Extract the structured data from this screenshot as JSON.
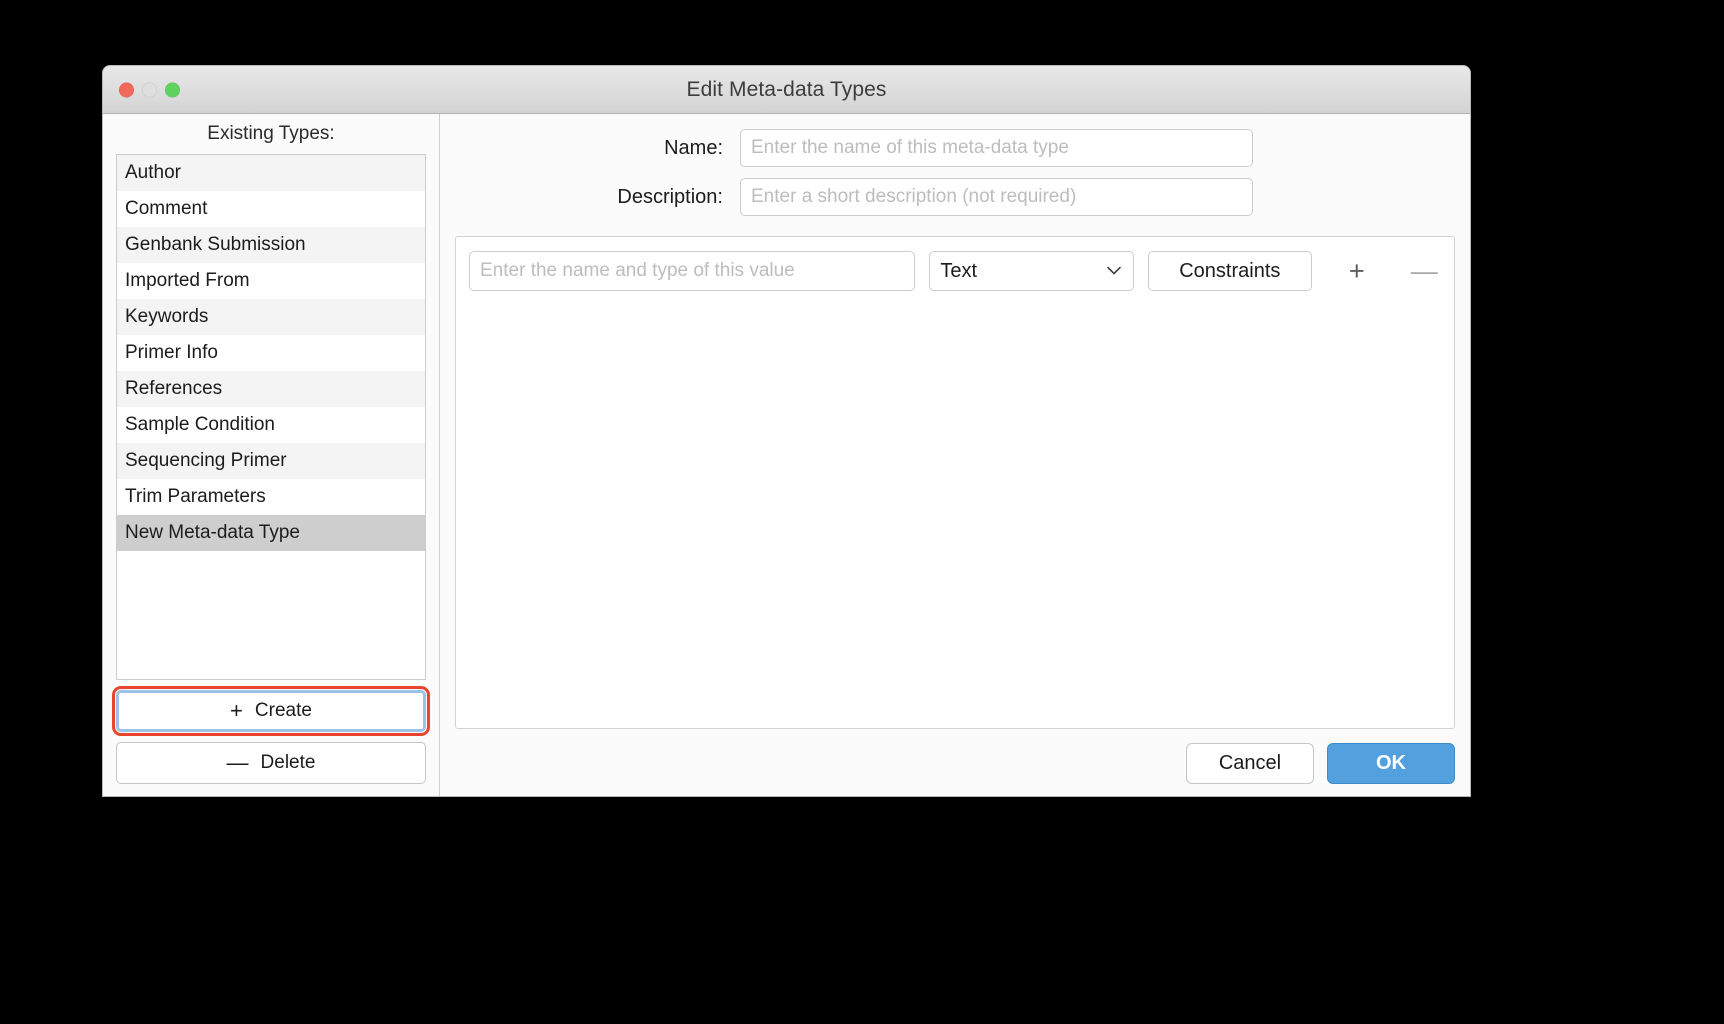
{
  "window": {
    "title": "Edit Meta-data Types",
    "traffic_lights": {
      "close": "close-button",
      "minimize": "minimize-button",
      "maximize": "maximize-button"
    }
  },
  "sidebar": {
    "heading": "Existing Types:",
    "items": [
      {
        "label": "Author",
        "selected": false
      },
      {
        "label": "Comment",
        "selected": false
      },
      {
        "label": "Genbank Submission",
        "selected": false
      },
      {
        "label": "Imported From",
        "selected": false
      },
      {
        "label": "Keywords",
        "selected": false
      },
      {
        "label": "Primer Info",
        "selected": false
      },
      {
        "label": "References",
        "selected": false
      },
      {
        "label": "Sample Condition",
        "selected": false
      },
      {
        "label": "Sequencing Primer",
        "selected": false
      },
      {
        "label": "Trim Parameters",
        "selected": false
      },
      {
        "label": "New Meta-data Type",
        "selected": true
      }
    ],
    "create_button": {
      "label": "Create",
      "icon": "plus-icon",
      "glyph": "+",
      "highlighted": true
    },
    "delete_button": {
      "label": "Delete",
      "icon": "minus-icon",
      "glyph": "—",
      "highlighted": false
    }
  },
  "form": {
    "name_label": "Name:",
    "name_value": "",
    "name_placeholder": "Enter the name of this meta-data type",
    "description_label": "Description:",
    "description_value": "",
    "description_placeholder": "Enter a short description (not required)"
  },
  "values": {
    "value_name_value": "",
    "value_name_placeholder": "Enter the name and type of this value",
    "type_selected": "Text",
    "type_options": [
      "Text"
    ],
    "constraints_label": "Constraints",
    "add_glyph": "+",
    "remove_glyph": "—"
  },
  "footer": {
    "cancel_label": "Cancel",
    "ok_label": "OK"
  },
  "colors": {
    "accent": "#52a0dd",
    "highlight": "#e8442e",
    "selection": "#cecece",
    "focus_ring": "#9dc2e8"
  }
}
